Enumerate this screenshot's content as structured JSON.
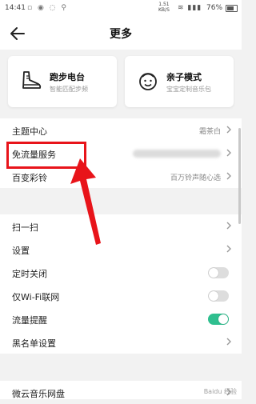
{
  "status_bar": {
    "time": "14:41",
    "net_speed": "1.51",
    "net_unit": "KB/S",
    "battery": "76%"
  },
  "header": {
    "title": "更多"
  },
  "cards": [
    {
      "title": "跑步电台",
      "subtitle": "智能匹配步频",
      "icon": "running-shoe-icon"
    },
    {
      "title": "亲子模式",
      "subtitle": "宝宝定制音乐包",
      "icon": "child-face-icon"
    }
  ],
  "section1": [
    {
      "label": "主题中心",
      "value": "霜茶白"
    },
    {
      "label": "免流量服务",
      "value": ""
    },
    {
      "label": "百变彩铃",
      "value": "百万铃声随心选"
    }
  ],
  "section2": [
    {
      "label": "扫一扫",
      "control": "chevron"
    },
    {
      "label": "设置",
      "control": "chevron"
    },
    {
      "label": "定时关闭",
      "control": "toggle",
      "on": false
    },
    {
      "label": "仅Wi-Fi联网",
      "control": "toggle",
      "on": false
    },
    {
      "label": "流量提醒",
      "control": "toggle",
      "on": true
    },
    {
      "label": "黑名单设置",
      "control": "chevron"
    }
  ],
  "section3": [
    {
      "label": "微云音乐网盘"
    }
  ],
  "colors": {
    "accent_toggle": "#2fbf8f",
    "annotation_red": "#e8141a"
  },
  "watermark": "Baidu 经验"
}
